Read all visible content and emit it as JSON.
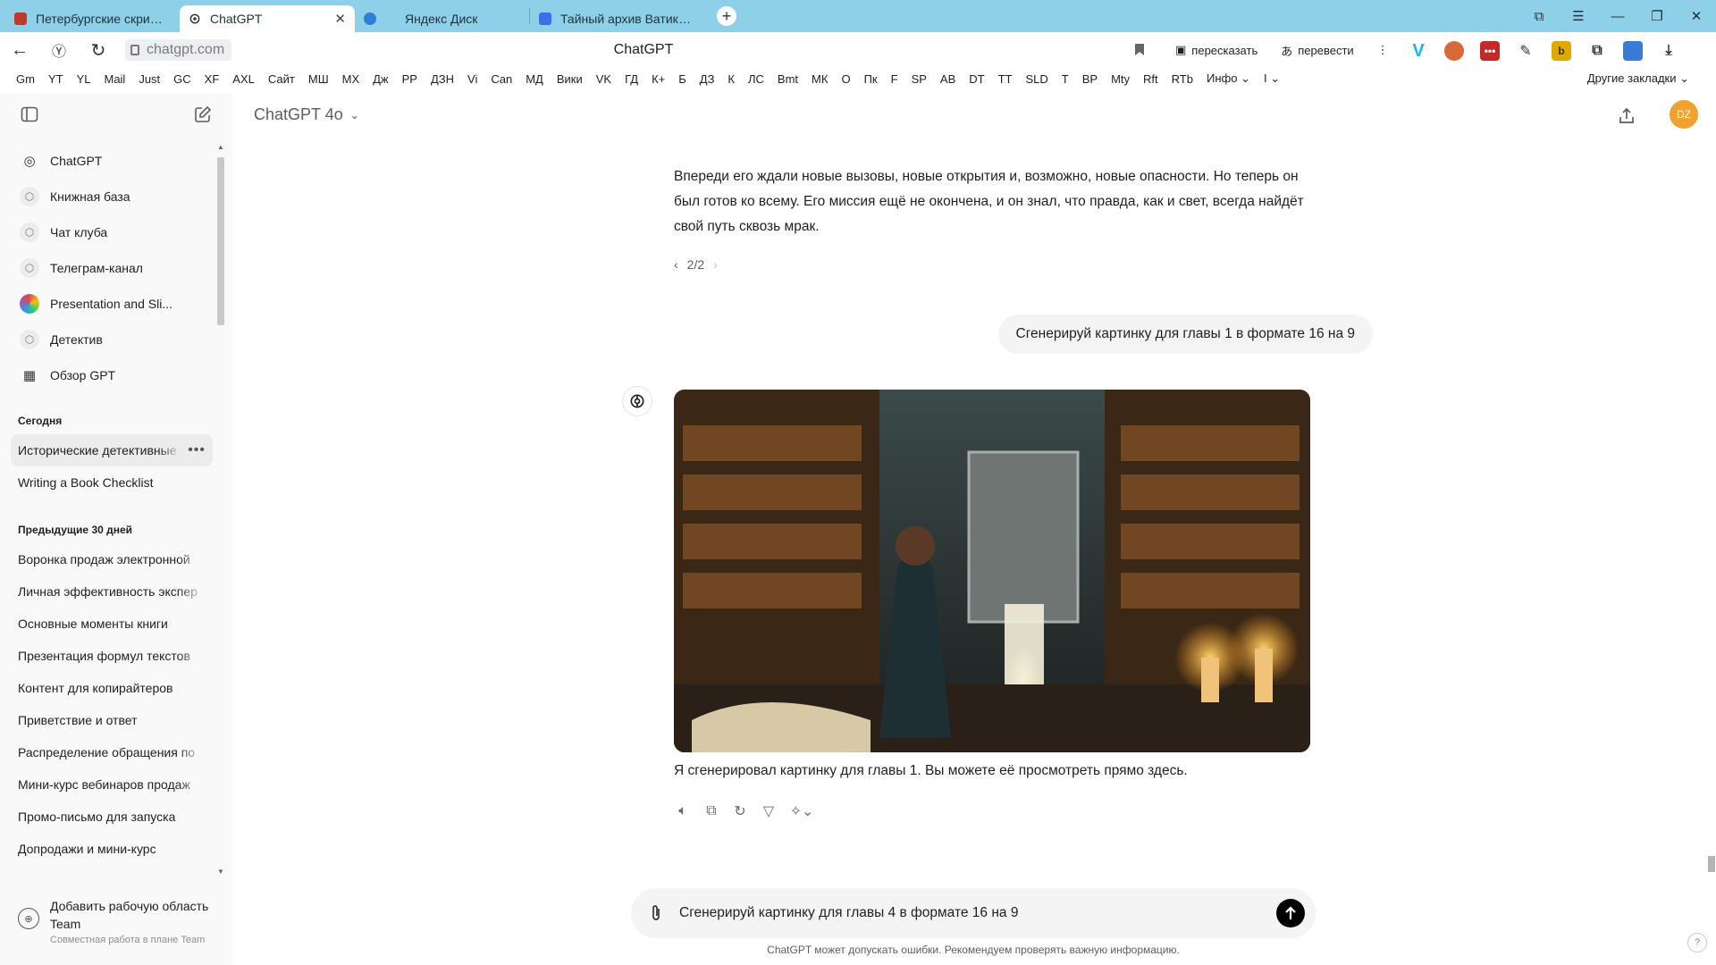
{
  "browser": {
    "tabs": [
      {
        "label": "Петербургские скрижали",
        "icon": "book-icon",
        "color": "#c0392b"
      },
      {
        "label": "ChatGPT",
        "icon": "openai-icon",
        "color": "#1f1f1f"
      },
      {
        "label": "Яндекс Диск",
        "icon": "cloud-icon",
        "color": "#2f7fd7"
      },
      {
        "label": "Тайный архив Ватикана.d",
        "icon": "docs-icon",
        "color": "#3b6ee8"
      }
    ],
    "address": "chatgpt.com",
    "page_title": "ChatGPT",
    "retell_label": "пересказать",
    "translate_label": "перевести",
    "bookmarks": [
      "Gm",
      "YT",
      "YL",
      "Mail",
      "Just",
      "GC",
      "XF",
      "AXL",
      "Сайт",
      "МШ",
      "МХ",
      "Дж",
      "РР",
      "ДЗН",
      "Vi",
      "Can",
      "МД",
      "Вики",
      "VK",
      "ГД",
      "К+",
      "Б",
      "ДЗ",
      "К",
      "ЛС",
      "Bmt",
      "МК",
      "О",
      "Пк",
      "F",
      "SP",
      "AB",
      "DT",
      "TT",
      "SLD",
      "T",
      "BP",
      "Mty",
      "Rft",
      "RTb",
      "Инфо ⌄",
      "I ⌄"
    ],
    "other_bookmarks": "Другие закладки ⌄"
  },
  "sidebar": {
    "gpts": [
      {
        "label": "ChatGPT",
        "icon": "openai-icon"
      },
      {
        "label": "Книжная база",
        "icon": "cube-icon"
      },
      {
        "label": "Чат клуба",
        "icon": "cube-icon"
      },
      {
        "label": "Телеграм-канал",
        "icon": "cube-icon"
      },
      {
        "label": "Presentation and Sli...",
        "icon": "rainbow-icon"
      },
      {
        "label": "Детектив",
        "icon": "cube-icon"
      },
      {
        "label": "Обзор GPT",
        "icon": "grid-icon"
      }
    ],
    "today_heading": "Сегодня",
    "today": [
      "Исторические детективные",
      "Writing a Book Checklist"
    ],
    "prev_heading": "Предыдущие 30 дней",
    "previous": [
      "Воронка продаж электронной",
      "Личная эффективность экспер",
      "Основные моменты книги",
      "Презентация формул текстов",
      "Контент для копирайтеров",
      "Приветствие и ответ",
      "Распределение обращения по",
      "Мини-курс вебинаров продаж",
      "Промо-письмо для запуска",
      "Допродажи и мини-курс"
    ],
    "footer_title": "Добавить рабочую область Team",
    "footer_sub": "Совместная работа в плане Team"
  },
  "main": {
    "model": "ChatGPT 4o",
    "avatar_initials": "DZ",
    "assistant_text": "Впереди его ждали новые вызовы, новые открытия и, возможно, новые опасности. Но теперь он был готов ко всему. Его миссия ещё не окончена, и он знал, что правда, как и свет, всегда найдёт свой путь сквозь мрак.",
    "pager": "2/2",
    "user_message": "Сгенерируй картинку для главы 1 в формате 16 на 9",
    "image_caption": "Я сгенерировал картинку для главы 1. Вы можете её просмотреть прямо здесь.",
    "composer_value": "Сгенерируй картинку для главы 4 в формате 16 на 9",
    "disclaimer": "ChatGPT может допускать ошибки. Рекомендуем проверять важную информацию.",
    "help": "?"
  },
  "colors": {
    "tabstrip": "#8fd0e9",
    "sidebar_bg": "#f9f9f9",
    "avatar": "#f0a22e",
    "bubble": "#f4f4f4"
  }
}
